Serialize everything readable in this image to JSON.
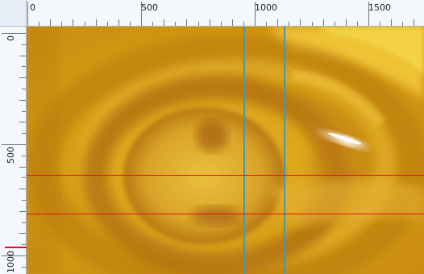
{
  "rulers": {
    "horizontal_labels": [
      "0",
      "500",
      "1000",
      "1500"
    ],
    "vertical_labels": [
      "0",
      "500",
      "1000"
    ]
  },
  "guides": {
    "vertical_color": "#4f96a0",
    "horizontal_color": "#e3141b"
  },
  "image": {
    "base_color": "#d39a13",
    "dark_color": "#a8650d",
    "light_color": "#f2c93a",
    "highlight_color": "#ffffff"
  }
}
